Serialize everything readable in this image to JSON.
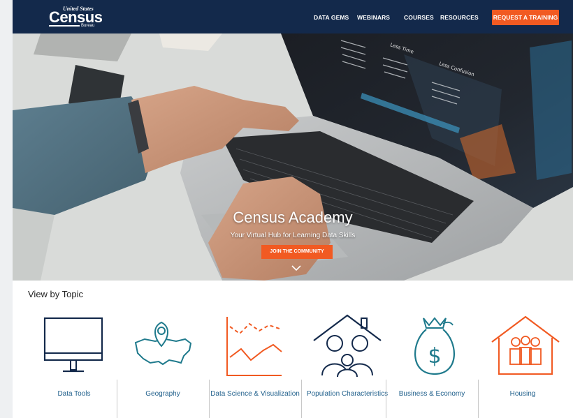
{
  "header": {
    "logo": {
      "line1": "United States",
      "line2": "Census",
      "line3": "Bureau"
    },
    "nav": [
      "DATA GEMS",
      "WEBINARS",
      "COURSES",
      "RESOURCES"
    ],
    "cta": "REQUEST A TRAINING"
  },
  "hero": {
    "title": "Census Academy",
    "subtitle": "Your Virtual Hub for Learning Data Skills",
    "button": "JOIN THE COMMUNITY",
    "screen_text": [
      "Less Time",
      "Less Confusion"
    ]
  },
  "topics": {
    "heading": "View by Topic",
    "items": [
      {
        "label": "Data Tools",
        "icon": "monitor-icon"
      },
      {
        "label": "Geography",
        "icon": "us-map-pin-icon"
      },
      {
        "label": "Data Science & Visualization",
        "icon": "line-chart-icon"
      },
      {
        "label": "Population Characteristics",
        "icon": "family-house-icon"
      },
      {
        "label": "Business & Economy",
        "icon": "money-bag-icon"
      },
      {
        "label": "Housing",
        "icon": "home-family-icon"
      }
    ]
  },
  "colors": {
    "navy": "#13294b",
    "orange": "#f15a22",
    "teal": "#1f7a8c",
    "link": "#1f5f8b"
  }
}
